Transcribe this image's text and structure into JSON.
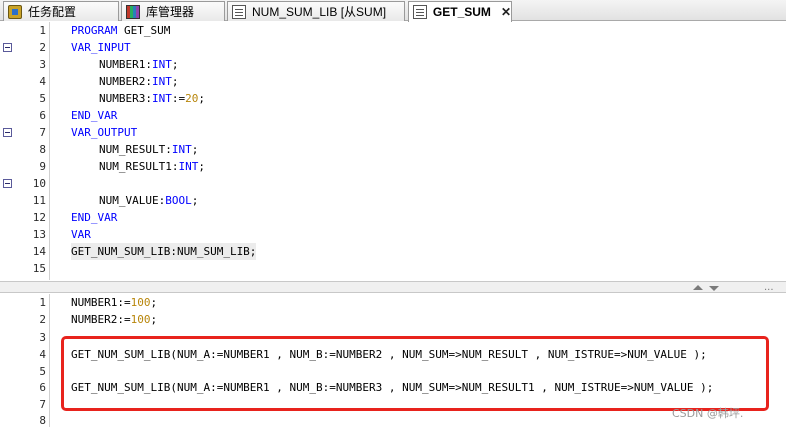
{
  "tabs": [
    {
      "label": "任务配置",
      "icon": "config-icon"
    },
    {
      "label": "库管理器",
      "icon": "library-manager-icon"
    },
    {
      "label": "NUM_SUM_LIB [从SUM]",
      "icon": "document-icon"
    },
    {
      "label": "GET_SUM",
      "icon": "document-icon",
      "active": true,
      "close": "✕"
    }
  ],
  "declaration": {
    "lines": [
      {
        "n": "1",
        "text": "PROGRAM GET_SUM"
      },
      {
        "n": "2",
        "text": "VAR_INPUT"
      },
      {
        "n": "3",
        "text": "NUMBER1:INT;"
      },
      {
        "n": "4",
        "text": "NUMBER2:INT;"
      },
      {
        "n": "5",
        "text": "NUMBER3:INT:=20;"
      },
      {
        "n": "6",
        "text": "END_VAR"
      },
      {
        "n": "7",
        "text": "VAR_OUTPUT"
      },
      {
        "n": "8",
        "text": "NUM_RESULT:INT;"
      },
      {
        "n": "9",
        "text": "NUM_RESULT1:INT;"
      },
      {
        "n": "10",
        "text": ""
      },
      {
        "n": "11",
        "text": "NUM_VALUE:BOOL;"
      },
      {
        "n": "12",
        "text": "END_VAR"
      },
      {
        "n": "13",
        "text": "VAR"
      },
      {
        "n": "14",
        "text": "GET_NUM_SUM_LIB:NUM_SUM_LIB;"
      },
      {
        "n": "15",
        "text": ""
      }
    ]
  },
  "implementation": {
    "lines": [
      {
        "n": "1",
        "text": "NUMBER1:=100;"
      },
      {
        "n": "2",
        "text": "NUMBER2:=100;"
      },
      {
        "n": "3",
        "text": ""
      },
      {
        "n": "4",
        "text": "GET_NUM_SUM_LIB(NUM_A:=NUMBER1 , NUM_B:=NUMBER2 , NUM_SUM=>NUM_RESULT , NUM_ISTRUE=>NUM_VALUE );"
      },
      {
        "n": "5",
        "text": ""
      },
      {
        "n": "6",
        "text": "GET_NUM_SUM_LIB(NUM_A:=NUMBER1 , NUM_B:=NUMBER3 , NUM_SUM=>NUM_RESULT1 , NUM_ISTRUE=>NUM_VALUE );"
      },
      {
        "n": "7",
        "text": ""
      },
      {
        "n": "8",
        "text": ""
      }
    ]
  },
  "splitter": {
    "dots": "..."
  },
  "watermark": "CSDN @韩坪.",
  "colors": {
    "keyword": "#0000ff",
    "number": "#b8860b",
    "highlight_box": "#e8231d"
  }
}
